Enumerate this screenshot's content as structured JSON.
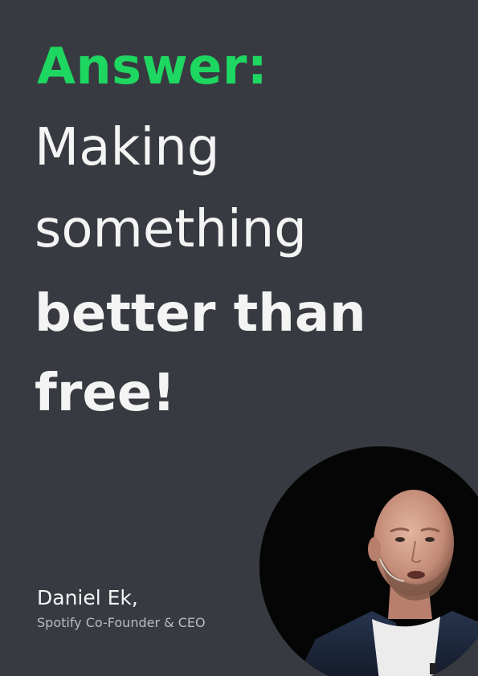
{
  "heading": {
    "label": "Answer:"
  },
  "quote": {
    "line1": "Making",
    "line2": "something",
    "line3": "better than",
    "line4": "free!"
  },
  "author": {
    "name": "Daniel Ek,",
    "role": "Spotify Co-Founder & CEO"
  },
  "colors": {
    "background": "#383a41",
    "accent": "#1ed760",
    "text": "#f4f4f4",
    "muted": "#b9bbc1"
  },
  "photo": {
    "icon": "portrait-photo"
  }
}
